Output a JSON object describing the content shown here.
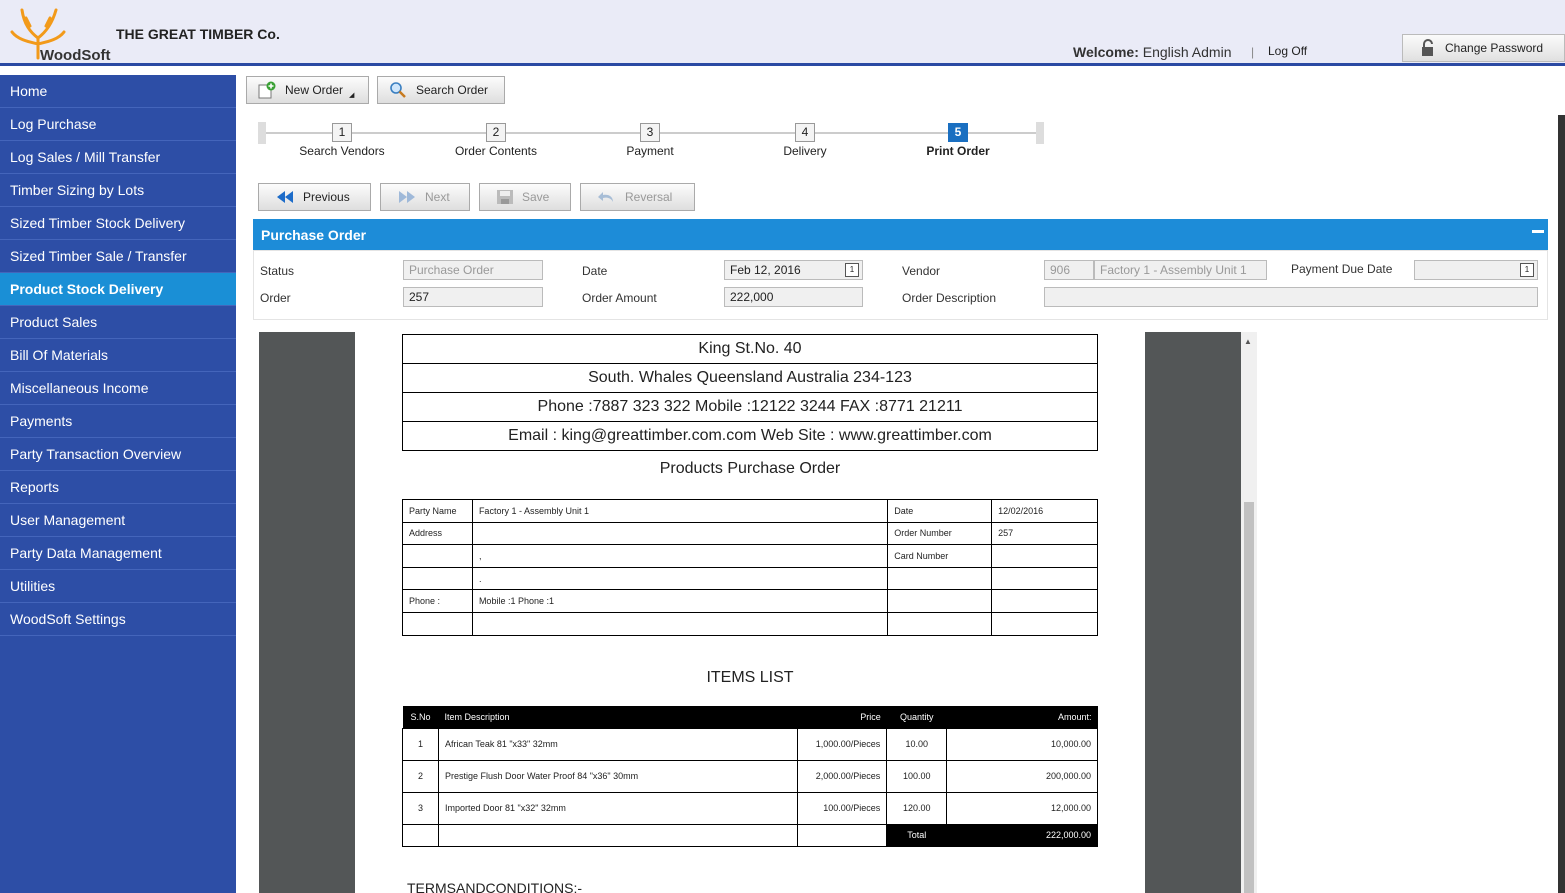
{
  "header": {
    "logo_text": "WoodSoft",
    "company": "THE GREAT TIMBER Co.",
    "welcome_label": "Welcome:",
    "welcome_user": "English Admin",
    "separator": "|",
    "logoff": "Log Off",
    "change_password": "Change Password"
  },
  "sidebar": {
    "items": [
      "Home",
      "Log Purchase",
      "Log Sales / Mill Transfer",
      "Timber Sizing by Lots",
      "Sized Timber Stock Delivery",
      "Sized Timber Sale / Transfer",
      "Product Stock Delivery",
      "Product Sales",
      "Bill Of Materials",
      "Miscellaneous Income",
      "Payments",
      "Party Transaction Overview",
      "Reports",
      "User Management",
      "Party Data Management",
      "Utilities",
      "WoodSoft Settings"
    ],
    "active": "Product Stock Delivery"
  },
  "toolbar": {
    "new_order": "New Order",
    "search_order": "Search Order"
  },
  "wizard": {
    "steps": [
      {
        "num": "1",
        "label": "Search Vendors"
      },
      {
        "num": "2",
        "label": "Order Contents"
      },
      {
        "num": "3",
        "label": "Payment"
      },
      {
        "num": "4",
        "label": "Delivery"
      },
      {
        "num": "5",
        "label": "Print Order"
      }
    ],
    "active_step": 5
  },
  "actions": {
    "previous": "Previous",
    "next": "Next",
    "save": "Save",
    "reversal": "Reversal"
  },
  "panel": {
    "title": "Purchase Order",
    "status_label": "Status",
    "status_value": "Purchase Order",
    "date_label": "Date",
    "date_value": "Feb 12, 2016",
    "vendor_label": "Vendor",
    "vendor_code": "906",
    "vendor_name": "Factory 1 - Assembly Unit 1",
    "payment_due_label": "Payment Due Date",
    "payment_due_value": "",
    "order_label": "Order",
    "order_value": "257",
    "amount_label": "Order Amount",
    "amount_value": "222,000",
    "desc_label": "Order Description",
    "desc_value": ""
  },
  "report": {
    "address_lines": [
      "King St.No. 40",
      "South. Whales  Queensland Australia 234-123",
      "Phone :7887 323 322 Mobile :12122 3244 FAX :8771 21211",
      "Email : king@greattimber.com.com Web Site : www.greattimber.com"
    ],
    "title": "Products Purchase Order",
    "party_name_label": "Party Name",
    "party_name": "Factory 1 - Assembly Unit 1",
    "address_label": "Address",
    "addr_line2": ",",
    "addr_line3": ".",
    "phone_label": "Phone :",
    "phone_value": "Mobile :1 Phone :1",
    "date_label": "Date",
    "date_value": "12/02/2016",
    "order_number_label": "Order Number",
    "order_number": "257",
    "card_number_label": "Card Number",
    "items_title": "ITEMS  LIST",
    "items_headers": [
      "S.No",
      "Item Description",
      "Price",
      "Quantity",
      "Amount:"
    ],
    "items": [
      {
        "sno": "1",
        "desc": "African Teak 81 \"x33\"  32mm",
        "price": "1,000.00/Pieces",
        "qty": "10.00",
        "amount": "10,000.00"
      },
      {
        "sno": "2",
        "desc": "Prestige Flush Door Water Proof 84 \"x36\"  30mm",
        "price": "2,000.00/Pieces",
        "qty": "100.00",
        "amount": "200,000.00"
      },
      {
        "sno": "3",
        "desc": "Imported Door 81 \"x32\"  32mm",
        "price": "100.00/Pieces",
        "qty": "120.00",
        "amount": "12,000.00"
      }
    ],
    "total_label": "Total",
    "total_value": "222,000.00",
    "terms": "TERMSANDCONDITIONS:-"
  }
}
